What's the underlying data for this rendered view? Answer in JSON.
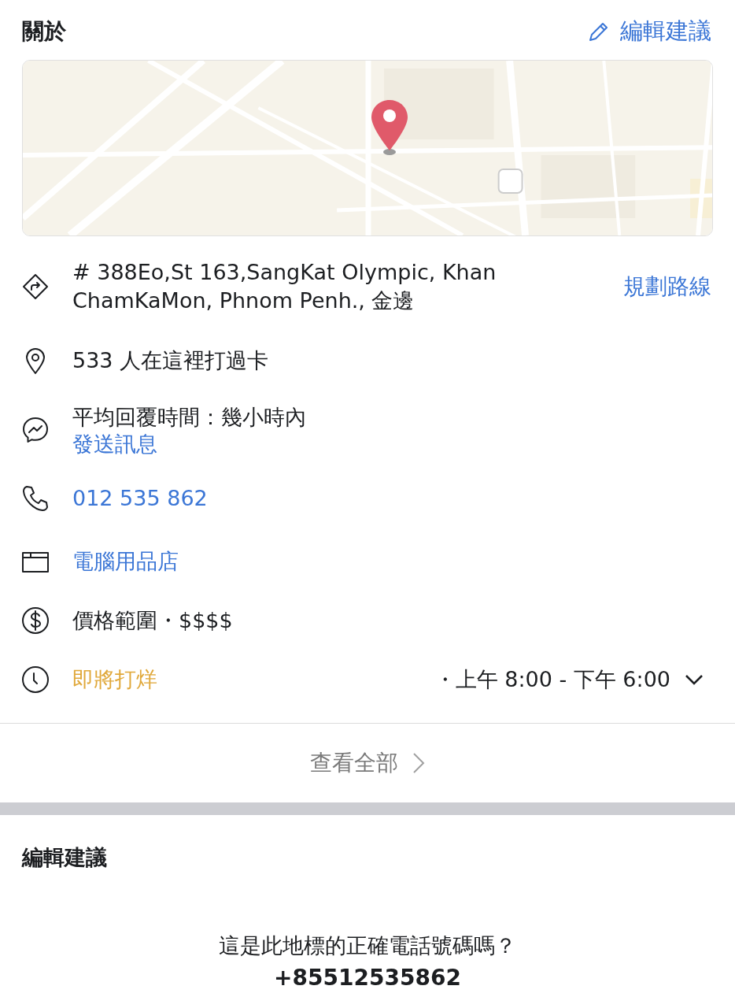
{
  "header": {
    "title": "關於",
    "edit_action": "編輯建議"
  },
  "rows": [
    {
      "kind": "directions",
      "lines": [
        "# 388Eo,St 163,SangKat Olympic, Khan",
        "ChamKaMon, Phnom Penh., 金邊"
      ],
      "action": "規劃路線"
    },
    {
      "kind": "checkins",
      "lines": [
        "533 人在這裡打過卡"
      ]
    },
    {
      "kind": "messenger",
      "lines": [
        "平均回覆時間：幾小時內"
      ],
      "link": "發送訊息"
    },
    {
      "kind": "phone",
      "link": "012 535 862"
    },
    {
      "kind": "category",
      "link": "電腦用品店"
    },
    {
      "kind": "price",
      "lines": [
        "價格範圍・$$$$"
      ]
    },
    {
      "kind": "hours",
      "status": "即將打烊",
      "hours": "・上午 8:00 - 下午 6:00",
      "expanded": false
    }
  ],
  "see_all": "查看全部",
  "suggest": {
    "title": "編輯建議",
    "question": "這是此地標的正確電話號碼嗎？",
    "number": "+85512535862"
  }
}
